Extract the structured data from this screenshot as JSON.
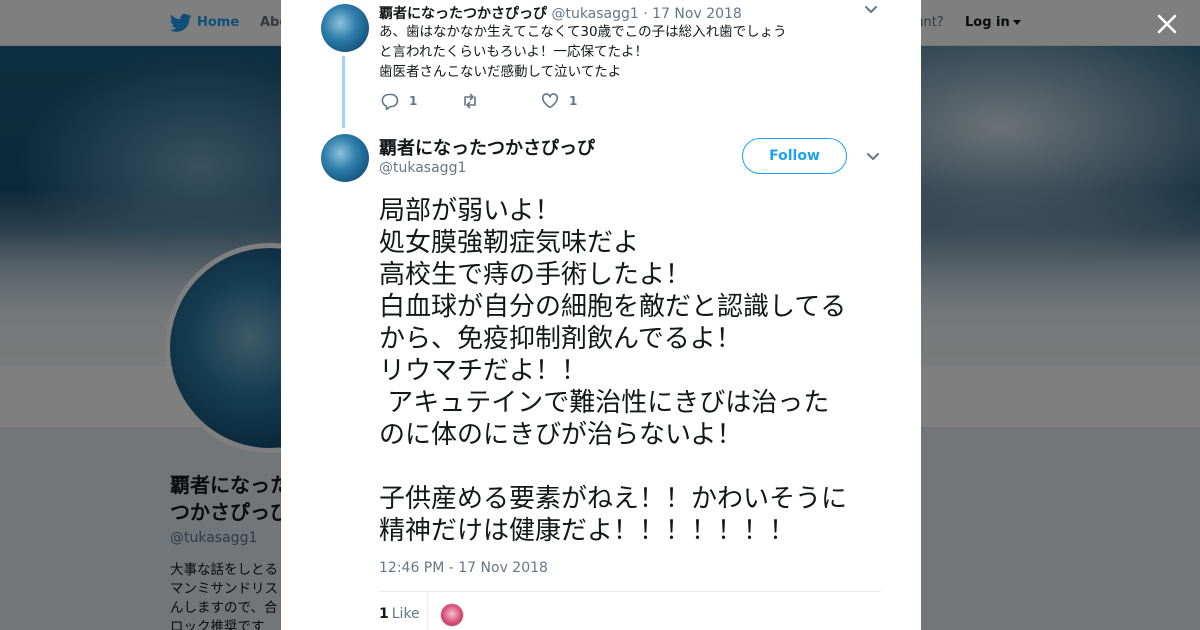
{
  "topbar": {
    "home_label": "Home",
    "about_label": "Abo",
    "account_prompt": "ccount?",
    "login_label": "Log in"
  },
  "profile": {
    "name": "覇者になったつかさぴっぴ",
    "handle": "@tukasagg1",
    "bio": "大事な話をしとるマンミサンドリスんしますので、合ロック推奨です"
  },
  "parent_tweet": {
    "name": "覇者になったつかさぴっぴ",
    "handle": "@tukasagg1",
    "dot": "·",
    "date": "17 Nov 2018",
    "lines": [
      "あ、歯はなかなか生えてこなくて30歳でこの子は総入れ歯でしょう",
      "と言われたくらいもろいよ！一応保てたよ！",
      "歯医者さんこないだ感動して泣いてたよ"
    ],
    "reply_count": "1",
    "retweet_count": "",
    "like_count": "1"
  },
  "main_tweet": {
    "name": "覇者になったつかさぴっぴ",
    "handle": "@tukasagg1",
    "follow_label": "Follow",
    "lines": [
      "局部が弱いよ！",
      "処女膜強靭症気味だよ",
      "高校生で痔の手術したよ！",
      "白血球が自分の細胞を敵だと認識してる",
      "から、免疫抑制剤飲んでるよ！",
      "リウマチだよ！！",
      " アキュテインで難治性にきびは治った",
      "のに体のにきびが治らないよ！",
      "",
      "子供産める要素がねえ！！かわいそうに",
      "精神だけは健康だよ！！！！！！！"
    ],
    "timestamp": "12:46 PM - 17 Nov 2018",
    "like_count": "1",
    "like_label": "Like"
  },
  "colors": {
    "accent": "#1da1f2",
    "text": "#14171a",
    "muted": "#657786",
    "thread_line": "#a0d4f7"
  },
  "icons": [
    "twitter-bird-icon",
    "close-icon",
    "chevron-down-icon",
    "reply-icon",
    "retweet-icon",
    "heart-icon"
  ]
}
